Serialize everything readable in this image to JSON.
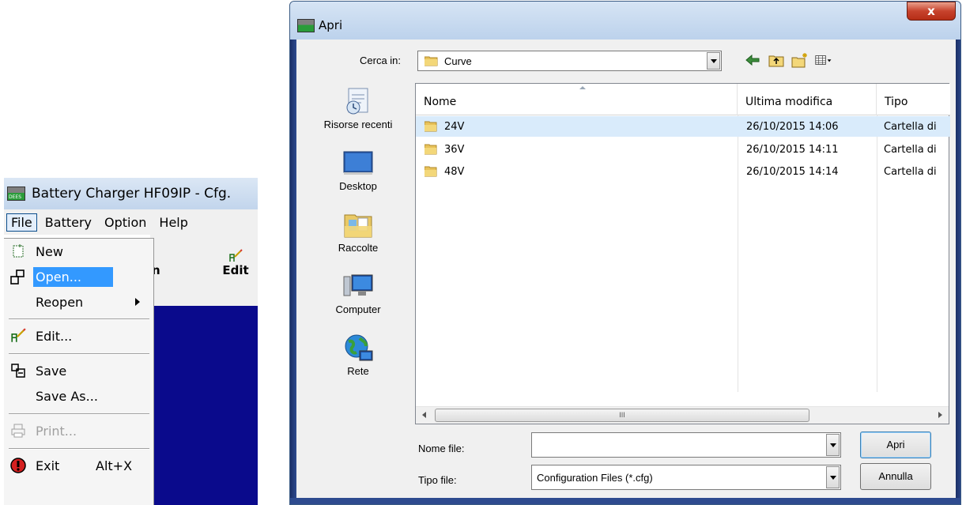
{
  "app": {
    "title": "Battery Charger HF09IP - Cfg.",
    "menubar": [
      "File",
      "Battery",
      "Option",
      "Help"
    ],
    "toolbar": {
      "edit_label": "Edit",
      "partial_label": "n"
    },
    "file_menu": {
      "items": [
        {
          "label": "New",
          "icon": "new-file-icon"
        },
        {
          "label": "Open...",
          "icon": "open-file-icon",
          "highlighted": true
        },
        {
          "label": "Reopen",
          "submenu": true
        },
        {
          "label": "Edit...",
          "icon": "edit-icon"
        },
        {
          "label": "Save",
          "icon": "save-icon"
        },
        {
          "label": "Save As..."
        },
        {
          "label": "Print...",
          "icon": "printer-icon",
          "disabled": true
        },
        {
          "label": "Exit",
          "icon": "exit-icon",
          "shortcut": "Alt+X"
        }
      ]
    }
  },
  "dialog": {
    "title": "Apri",
    "close_symbol": "x",
    "look_in_label": "Cerca in:",
    "look_in_value": "Curve",
    "places": [
      "Risorse recenti",
      "Desktop",
      "Raccolte",
      "Computer",
      "Rete"
    ],
    "columns": [
      "Nome",
      "Ultima modifica",
      "Tipo"
    ],
    "rows": [
      {
        "name": "24V",
        "modified": "26/10/2015 14:06",
        "type": "Cartella di",
        "selected": true
      },
      {
        "name": "36V",
        "modified": "26/10/2015 14:11",
        "type": "Cartella di"
      },
      {
        "name": "48V",
        "modified": "26/10/2015 14:14",
        "type": "Cartella di"
      }
    ],
    "scroll_thumb_grip": "III",
    "file_name_label": "Nome file:",
    "file_name_value": "",
    "file_type_label": "Tipo file:",
    "file_type_value": "Configuration Files (*.cfg)",
    "open_button": "Apri",
    "cancel_button": "Annulla"
  },
  "colors": {
    "workspace_blue": "#0a0a8c",
    "menu_highlight": "#3399ff",
    "selection": "#d9ebfb",
    "close_red": "#c7432d"
  }
}
